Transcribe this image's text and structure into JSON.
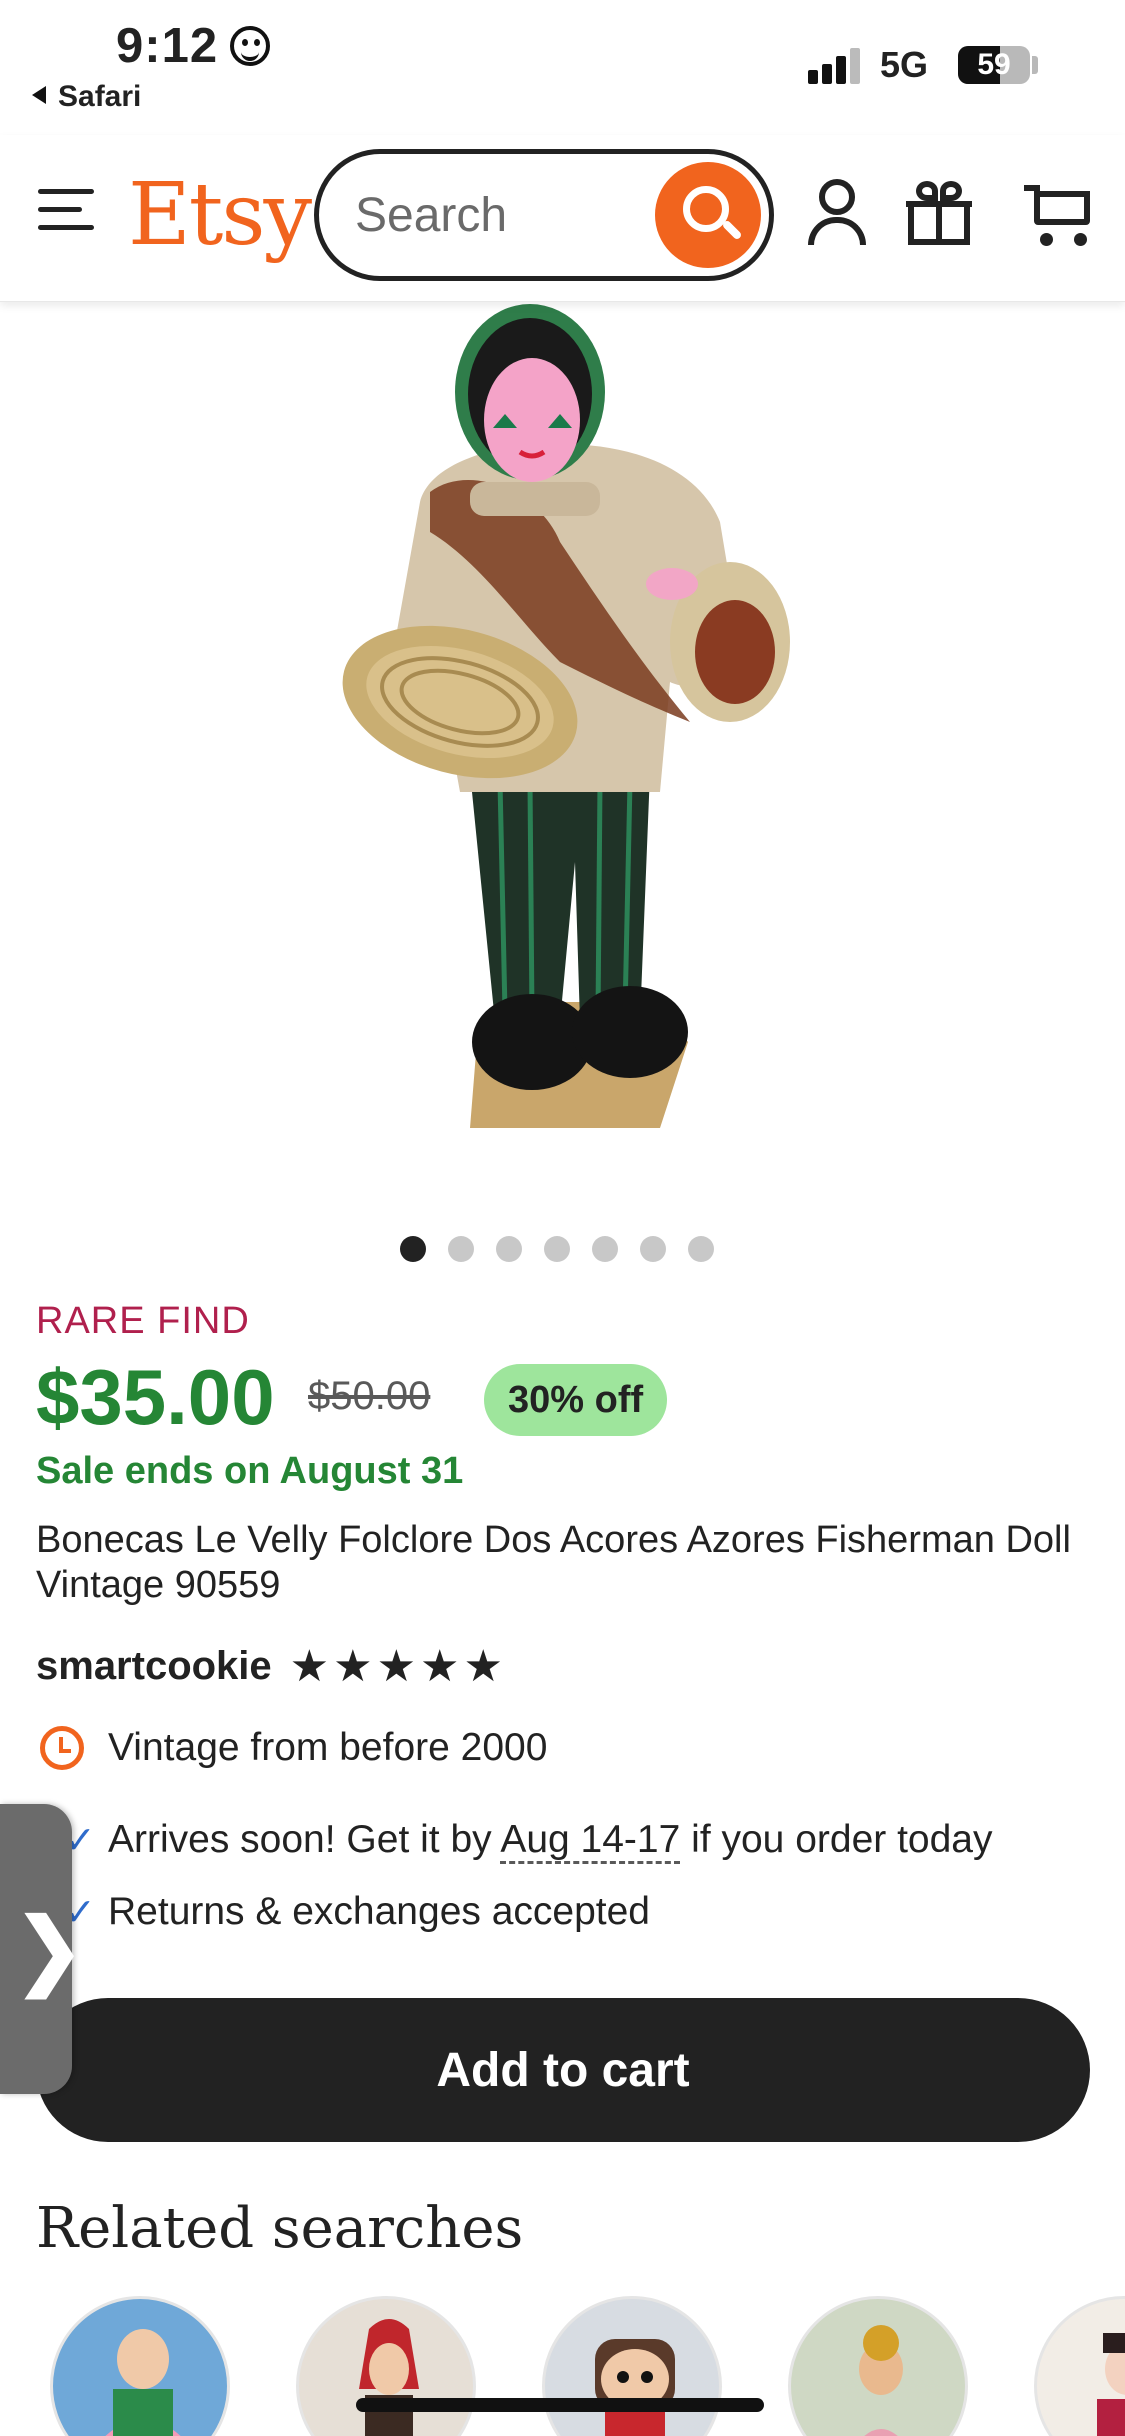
{
  "status_bar": {
    "time": "9:12",
    "back_app": "Safari",
    "network": "5G",
    "battery_level": "59",
    "battery_fraction": 0.59
  },
  "header": {
    "logo": "Etsy",
    "search_placeholder": "Search",
    "icons": [
      "menu-icon",
      "search-icon",
      "user-icon",
      "gift-icon",
      "cart-icon"
    ]
  },
  "carousel": {
    "total_images": 7,
    "active_index": 0
  },
  "listing": {
    "badge": "RARE FIND",
    "price": "$35.00",
    "original_price": "$50.00",
    "discount": "30% off",
    "sale_ends": "Sale ends on August 31",
    "title": "Bonecas Le Velly Folclore Dos Acores Azores Fisherman Doll Vintage 90559",
    "shop_name": "smartcookie",
    "rating_stars": 5,
    "stars_text": "★★★★★"
  },
  "features": {
    "vintage": "Vintage from before 2000",
    "arrives_prefix": "Arrives soon! Get it by ",
    "arrives_date": "Aug 14-17",
    "arrives_suffix": " if you order today",
    "returns": "Returns & exchanges accepted"
  },
  "side_tab_glyph": "❯",
  "add_to_cart_label": "Add to cart",
  "related": {
    "title": "Related searches"
  },
  "colors": {
    "brand": "#f1641e",
    "price_green": "#258635",
    "discount_bg": "#9ee59c",
    "rare_find": "#b0204d",
    "button_dark": "#222222"
  }
}
